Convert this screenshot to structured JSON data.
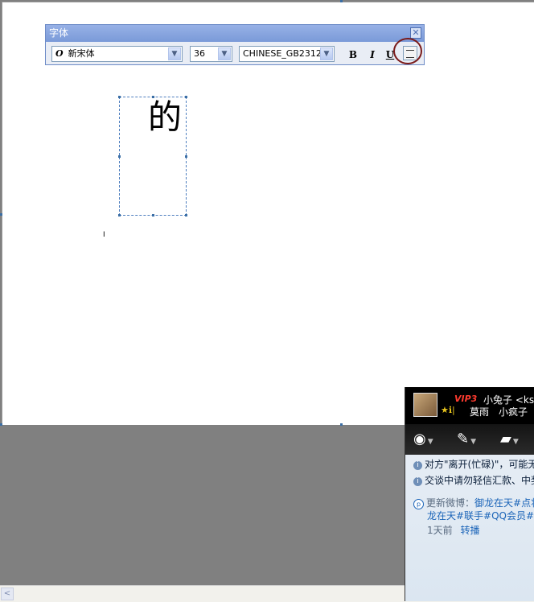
{
  "font_toolbar": {
    "title": "字体",
    "close_glyph": "✕",
    "font_name": "新宋体",
    "font_icon": "O",
    "font_size": "36",
    "charset": "CHINESE_GB2312",
    "bold": "B",
    "italic": "I",
    "underline": "U",
    "dropdown_glyph": "▼",
    "vertical_text_icon": "vertical-text-icon"
  },
  "canvas": {
    "text": "的",
    "cursor_mark": "I"
  },
  "scrollbar": {
    "left_arrow": "<"
  },
  "qq_chat": {
    "vip_badge": "VIP3",
    "contact_name": "小兔子 <ksz",
    "status_icons": "★ℹ|",
    "signature": "莫雨　小疯子　",
    "tools": [
      "webcam-icon",
      "microphone-icon",
      "folder-icon"
    ],
    "notice_1": "对方\"离开(忙碌)\"，可能无",
    "notice_2": "交谈中请勿轻信汇款、中奖",
    "weibo_prefix": "更新微博：",
    "weibo_line1": "御龙在天#点将",
    "weibo_line2": "龙在天#联手#QQ会员#陪",
    "weibo_time": "1天前",
    "weibo_repost": "转播"
  }
}
